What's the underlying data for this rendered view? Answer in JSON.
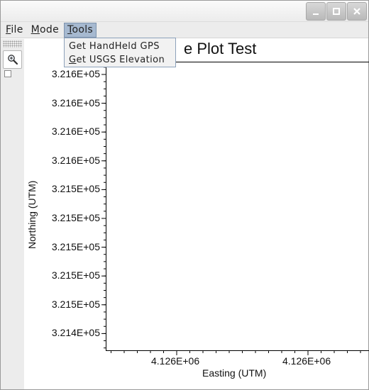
{
  "window": {
    "buttons": [
      {
        "name": "minimize-button",
        "icon": "minimize-icon"
      },
      {
        "name": "maximize-button",
        "icon": "maximize-icon"
      },
      {
        "name": "close-button",
        "icon": "close-icon"
      }
    ]
  },
  "menubar": {
    "file": {
      "mnemonic": "F",
      "rest": "ile"
    },
    "mode": {
      "mnemonic": "M",
      "rest": "ode"
    },
    "tools": {
      "mnemonic": "T",
      "rest": "ools"
    }
  },
  "tools_menu": {
    "item1": {
      "pre": "Get HandHeld GPS",
      "mnemonic": "",
      "rest": ""
    },
    "item2": {
      "pre": "",
      "mnemonic": "G",
      "rest": "et USGS Elevation"
    }
  },
  "toolbar": {
    "zoom_icon": "zoom-in-icon",
    "checkbox_checked": false
  },
  "chart_data": {
    "type": "scatter",
    "title_visible_part": "e Plot Test",
    "xlabel": "Easting (UTM)",
    "ylabel": "Northing (UTM)",
    "ytick_labels": [
      "3.216E+05",
      "3.216E+05",
      "3.216E+05",
      "3.216E+05",
      "3.215E+05",
      "3.215E+05",
      "3.215E+05",
      "3.215E+05",
      "3.215E+05",
      "3.214E+05"
    ],
    "xtick_labels": [
      "4.126E+06",
      "4.126E+06"
    ],
    "series": [],
    "grid": false
  }
}
